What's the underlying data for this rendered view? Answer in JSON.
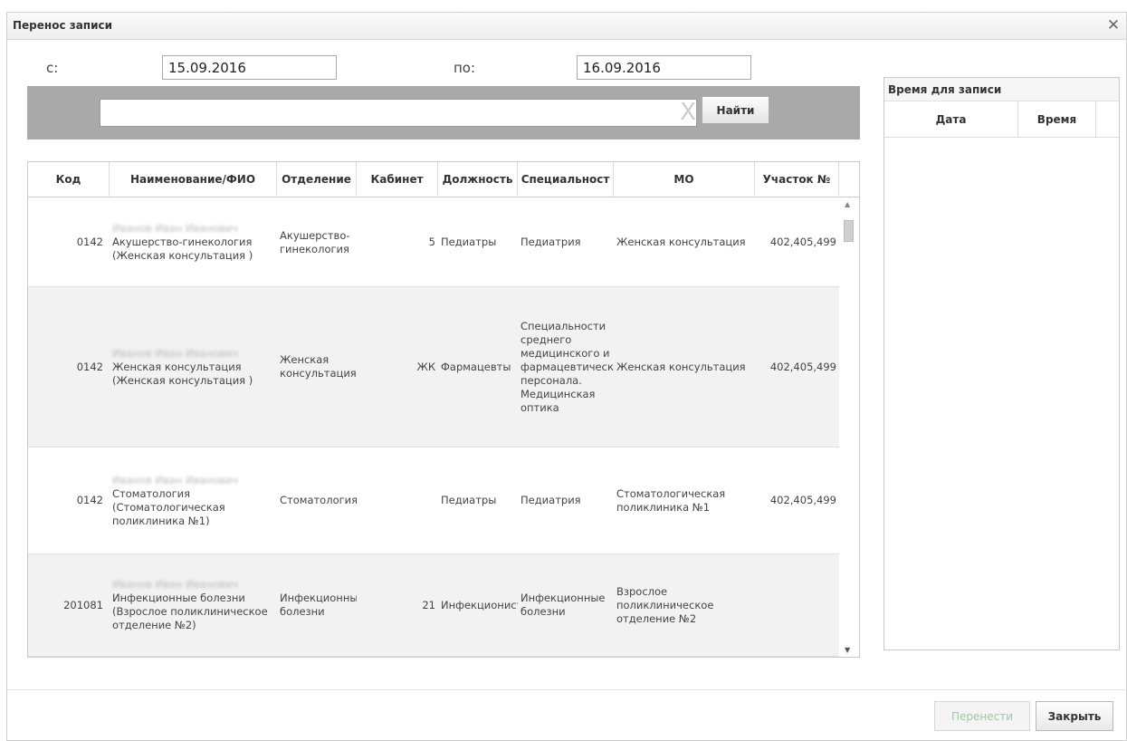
{
  "dialog": {
    "title": "Перенос записи",
    "close_icon": "close-icon"
  },
  "filters": {
    "from_label": "с:",
    "from_value": "15.09.2016",
    "to_label": "по:",
    "to_value": "16.09.2016"
  },
  "search": {
    "value": "",
    "clear_glyph": "X",
    "find_label": "Найти"
  },
  "table": {
    "columns": [
      "Код",
      "Наименование/ФИО",
      "Отделение",
      "Кабинет",
      "Должность",
      "Специальност",
      "МО",
      "Участок №"
    ],
    "rows": [
      {
        "code": "0142",
        "name_blurred": "Иванов Иван Иванович",
        "name_line2": "Акушерство-гинекология (Женская консультация )",
        "department": "Акушерство-гинекология",
        "cabinet": "5",
        "position": "Педиатры",
        "specialty": "Педиатрия",
        "mo": "Женская консультация",
        "district": "402,405,499"
      },
      {
        "code": "0142",
        "name_blurred": "Иванов Иван Иванович",
        "name_line2": "Женская консультация (Женская консультация )",
        "department": "Женская консультация",
        "cabinet": "ЖК",
        "position": "Фармацевты",
        "specialty": "Специальности среднего медицинского и фармацевтического персонала. Медицинская оптика",
        "mo": "Женская консультация",
        "district": "402,405,499"
      },
      {
        "code": "0142",
        "name_blurred": "Иванов Иван Иванович",
        "name_line2": "Стоматология (Стоматологическая поликлиника №1)",
        "department": "Стоматология",
        "cabinet": "",
        "position": "Педиатры",
        "specialty": "Педиатрия",
        "mo": "Стоматологическая поликлиника №1",
        "district": "402,405,499"
      },
      {
        "code": "201081",
        "name_blurred": "Иванов Иван Иванович",
        "name_line2": "Инфекционные болезни (Взрослое поликлиническое отделение №2)",
        "department": "Инфекционные болезни",
        "cabinet": "21",
        "position": "Инфекционисты",
        "specialty": "Инфекционные болезни",
        "mo": "Взрослое поликлиническое отделение №2",
        "district": ""
      }
    ]
  },
  "time_panel": {
    "title": "Время для записи",
    "col_date": "Дата",
    "col_time": "Время"
  },
  "footer": {
    "transfer_label": "Перенести",
    "close_label": "Закрыть"
  },
  "colors": {
    "search_bar_bg": "#a9a9a9",
    "row_alt_bg": "#f2f2f2",
    "disabled_text": "#9cc7a8"
  }
}
